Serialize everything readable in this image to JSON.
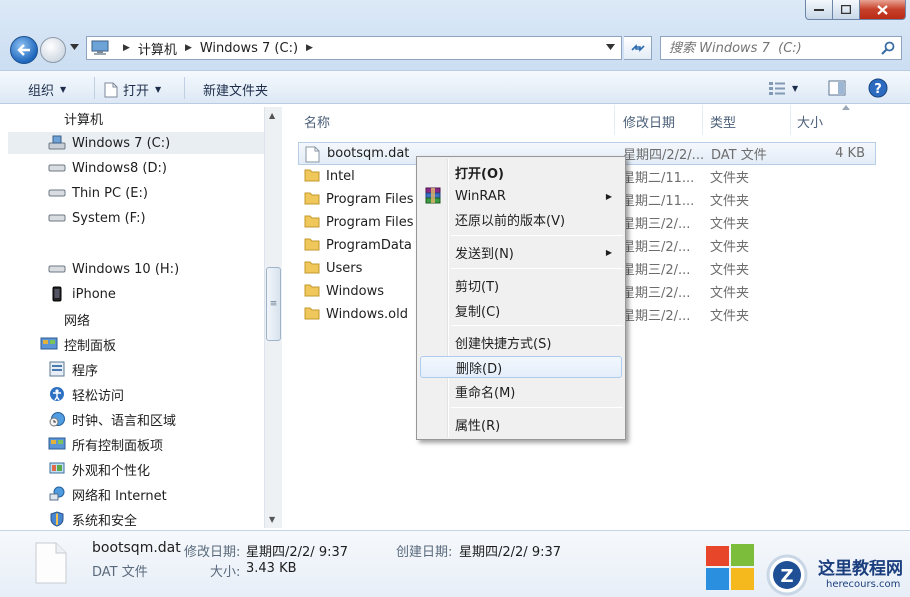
{
  "window": {
    "controls": {
      "minimize": "minimize",
      "maximize": "maximize",
      "close": "close"
    }
  },
  "address": {
    "crumbs": [
      "计算机",
      "Windows 7  (C:)"
    ],
    "search_placeholder": "搜索 Windows 7  (C:)"
  },
  "toolbar": {
    "organize": "组织",
    "open": "打开",
    "new_folder": "新建文件夹"
  },
  "navpane": {
    "items": [
      {
        "label": "计算机",
        "icon": "computer-icon"
      },
      {
        "label": "Windows 7  (C:)",
        "icon": "system-drive-icon"
      },
      {
        "label": "Windows8 (D:)",
        "icon": "drive-icon"
      },
      {
        "label": "Thin PC (E:)",
        "icon": "drive-icon"
      },
      {
        "label": "System (F:)",
        "icon": "drive-icon"
      },
      {
        "label": "Windows 10 (H:)",
        "icon": "drive-icon"
      },
      {
        "label": "iPhone",
        "icon": "phone-icon"
      },
      {
        "label": "网络",
        "icon": "network-icon"
      },
      {
        "label": "控制面板",
        "icon": "control-panel-icon"
      },
      {
        "label": "程序",
        "icon": "programs-icon"
      },
      {
        "label": "轻松访问",
        "icon": "ease-of-access-icon"
      },
      {
        "label": "时钟、语言和区域",
        "icon": "clock-globe-icon"
      },
      {
        "label": "所有控制面板项",
        "icon": "control-panel-icon"
      },
      {
        "label": "外观和个性化",
        "icon": "appearance-icon"
      },
      {
        "label": "网络和 Internet",
        "icon": "network-internet-icon"
      },
      {
        "label": "系统和安全",
        "icon": "system-security-icon"
      }
    ]
  },
  "filelist": {
    "columns": {
      "name": "名称",
      "date": "修改日期",
      "type": "类型",
      "size": "大小"
    },
    "rows": [
      {
        "name": "bootsqm.dat",
        "date": "星期四/2/2/...",
        "type": "DAT 文件",
        "size": "4 KB",
        "icon": "file-icon"
      },
      {
        "name": "Intel",
        "date": "星期二/11...",
        "type": "文件夹",
        "size": "",
        "icon": "folder-icon"
      },
      {
        "name": "Program Files",
        "date": "星期二/11...",
        "type": "文件夹",
        "size": "",
        "icon": "folder-icon"
      },
      {
        "name": "Program Files",
        "date": "星期三/2/...",
        "type": "文件夹",
        "size": "",
        "icon": "folder-icon"
      },
      {
        "name": "ProgramData",
        "date": "星期三/2/...",
        "type": "文件夹",
        "size": "",
        "icon": "folder-icon"
      },
      {
        "name": "Users",
        "date": "星期三/2/...",
        "type": "文件夹",
        "size": "",
        "icon": "folder-icon"
      },
      {
        "name": "Windows",
        "date": "星期三/2/...",
        "type": "文件夹",
        "size": "",
        "icon": "folder-icon"
      },
      {
        "name": "Windows.old",
        "date": "星期三/2/...",
        "type": "文件夹",
        "size": "",
        "icon": "folder-icon"
      }
    ]
  },
  "context_menu": {
    "open": "打开(O)",
    "winrar": "WinRAR",
    "restore": "还原以前的版本(V)",
    "send_to": "发送到(N)",
    "cut": "剪切(T)",
    "copy": "复制(C)",
    "shortcut": "创建快捷方式(S)",
    "delete": "删除(D)",
    "rename": "重命名(M)",
    "properties": "属性(R)"
  },
  "details": {
    "filename": "bootsqm.dat",
    "filetype": "DAT 文件",
    "modified_label": "修改日期:",
    "modified_value": "星期四/2/2/ 9:37",
    "created_label": "创建日期:",
    "created_value": "星期四/2/2/ 9:37",
    "size_label": "大小:",
    "size_value": "3.43 KB"
  },
  "watermark": {
    "title": "这里教程网",
    "url": "herecours.com"
  },
  "colors": {
    "chrome": "#dce9f7",
    "toolbar": "#e3ecf6",
    "selection": "#e3ecf7",
    "close_button": "#c6402a"
  }
}
